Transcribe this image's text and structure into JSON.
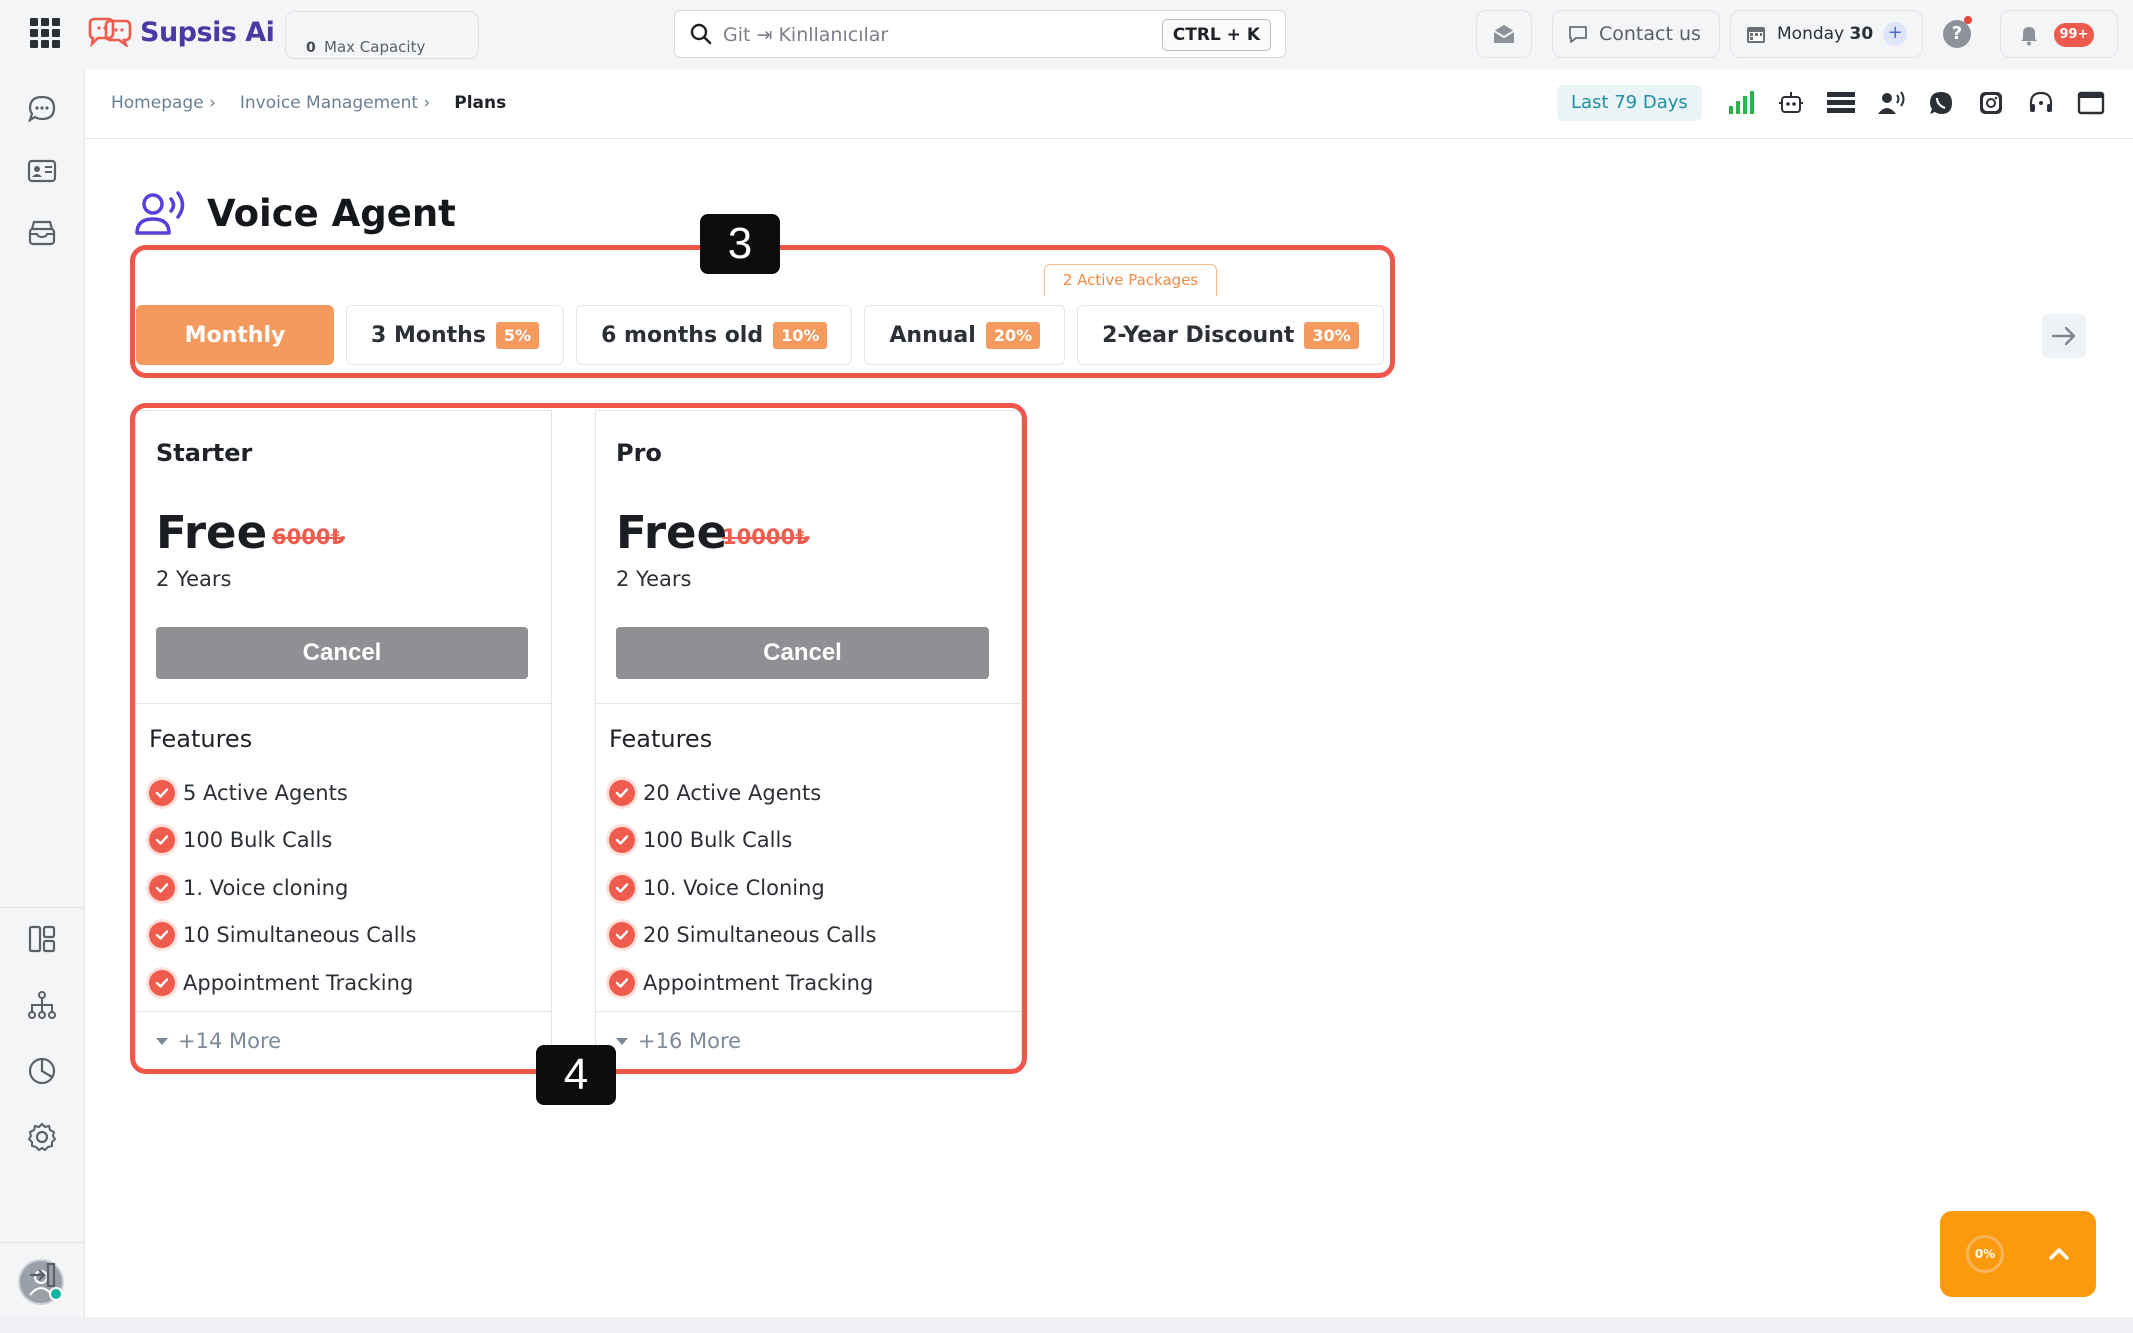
{
  "app": {
    "brand_name": "Supsis Ai",
    "capacity": {
      "value": "0",
      "label": "Max Capacity"
    },
    "search": {
      "placeholder": "Git ⇥ Kinllanıcılar",
      "shortcut": "CTRL + K"
    },
    "contact_label": "Contact us",
    "date": {
      "day": "Monday",
      "num": "30"
    },
    "notifications_badge": "99+"
  },
  "breadcrumb": {
    "items": [
      "Homepage ›",
      "Invoice Management ›"
    ],
    "current": "Plans"
  },
  "toolbar": {
    "range_label": "Last 79 Days",
    "quick_icons": [
      "signal-bars-icon",
      "bot-icon",
      "list-icon",
      "voice-agent-icon",
      "whatsapp-icon",
      "instagram-icon",
      "headset-icon",
      "window-icon"
    ]
  },
  "page": {
    "title": "Voice Agent",
    "active_packages_label": "2 Active Packages"
  },
  "periods": [
    {
      "label": "Monthly",
      "discount": "",
      "active": true
    },
    {
      "label": "3 Months",
      "discount": "5%"
    },
    {
      "label": "6 months old",
      "discount": "10%"
    },
    {
      "label": "Annual",
      "discount": "20%"
    },
    {
      "label": "2-Year Discount",
      "discount": "30%"
    }
  ],
  "plans": [
    {
      "name": "Starter",
      "price": "Free",
      "old_price": "6000₺",
      "duration": "2 Years",
      "button": "Cancel",
      "features_title": "Features",
      "features": [
        "5 Active Agents",
        "100 Bulk Calls",
        "1. Voice cloning",
        "10 Simultaneous Calls",
        "Appointment Tracking"
      ],
      "more": "+14 More"
    },
    {
      "name": "Pro",
      "price": "Free",
      "old_price": "10000₺",
      "duration": "2 Years",
      "button": "Cancel",
      "features_title": "Features",
      "features": [
        "20 Active Agents",
        "100 Bulk Calls",
        "10. Voice Cloning",
        "20 Simultaneous Calls",
        "Appointment Tracking"
      ],
      "more": "+16 More"
    }
  ],
  "annotations": {
    "box_a": "3",
    "box_b": "4"
  },
  "progress": {
    "label": "0%"
  },
  "colors": {
    "accent": "#f59a5e",
    "highlight": "#f0564a",
    "brand": "#4a3aa3",
    "progress": "#fb9a0e"
  }
}
